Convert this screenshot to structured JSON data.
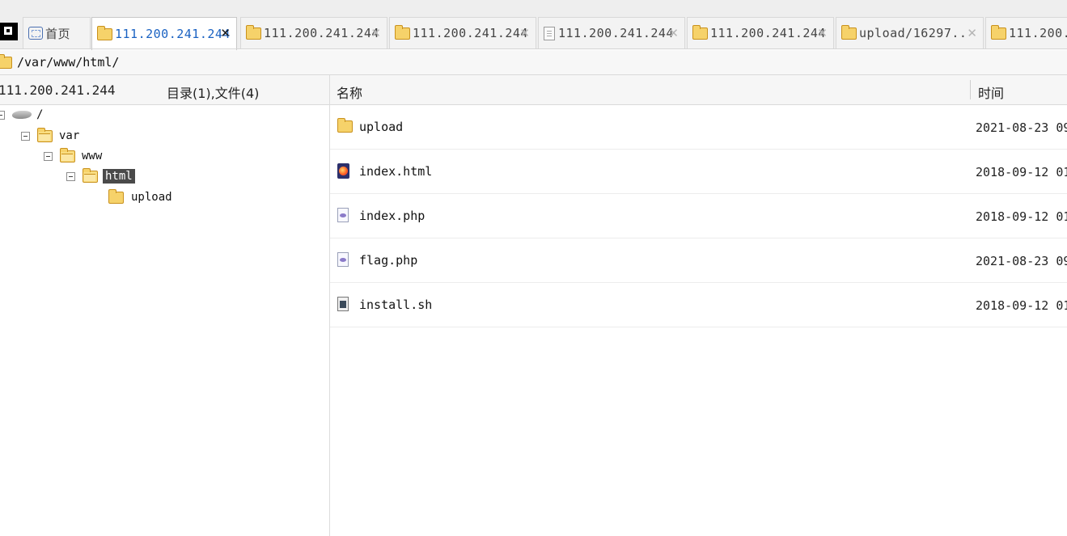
{
  "tabs": [
    {
      "label": "首页",
      "icon": "home-icon",
      "active": false
    },
    {
      "label": "111.200.241.244",
      "icon": "folder-icon",
      "active": true
    },
    {
      "label": "111.200.241.244",
      "icon": "folder-icon",
      "active": false
    },
    {
      "label": "111.200.241.244",
      "icon": "folder-icon",
      "active": false
    },
    {
      "label": "111.200.241.244",
      "icon": "document-icon",
      "active": false
    },
    {
      "label": "111.200.241.244",
      "icon": "folder-icon",
      "active": false
    },
    {
      "label": "upload/16297..",
      "icon": "folder-icon",
      "active": false
    },
    {
      "label": "111.200.",
      "icon": "folder-icon",
      "active": false
    }
  ],
  "path": "/var/www/html/",
  "header": {
    "host": "111.200.241.244",
    "summary": "目录(1),文件(4)",
    "col_name": "名称",
    "col_time": "时间"
  },
  "tree": {
    "root": "/",
    "var": "var",
    "www": "www",
    "html": "html",
    "upload": "upload"
  },
  "files": [
    {
      "name": "upload",
      "time": "2021-08-23 09",
      "icon": "folder-icon"
    },
    {
      "name": "index.html",
      "time": "2018-09-12 01",
      "icon": "firefox-file-icon"
    },
    {
      "name": "index.php",
      "time": "2018-09-12 01",
      "icon": "php-file-icon"
    },
    {
      "name": "flag.php",
      "time": "2021-08-23 09",
      "icon": "php-file-icon"
    },
    {
      "name": "install.sh",
      "time": "2018-09-12 01",
      "icon": "shell-file-icon"
    }
  ]
}
